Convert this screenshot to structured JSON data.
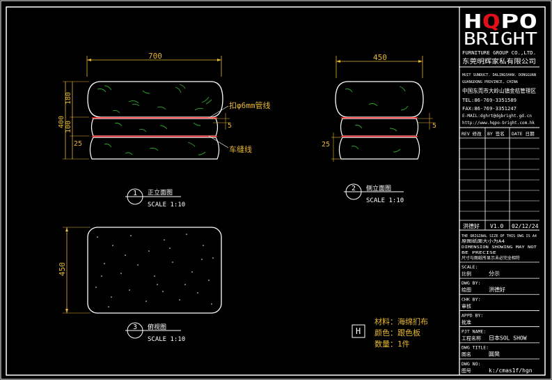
{
  "brand": {
    "logo_line1": "HQPO",
    "logo_line2": "BRIGHT",
    "logo_accent": "#e0101a",
    "company_en": "FURNITURE GROUP CO.,LTD.",
    "company_cn": "东莞明辉家私有限公司"
  },
  "address": {
    "en_line1": "HUIT SUNDUCT. DALINGSHAN. DONGGUAN",
    "en_line2": "GUANGDONG PROVINCE, CHINA",
    "cn_line": "中国东莞市大岭山镇金桔管理区",
    "tel": "TEL:86-769-3351589",
    "fax": "FAX:86-769-3351247",
    "email": "E-MAIL:dghrt@dgbright.gd.cn",
    "web": "http://www.hqpo-bright.com.hk"
  },
  "revision_header": {
    "rev": "REV 修改",
    "by": "BY 签名",
    "date": "DATE 日期"
  },
  "revision_row": {
    "rev": "洪德好",
    "by": "V1.0",
    "date": "02/12/24"
  },
  "notes": {
    "line1": "THE ORIGINAL SIZE OF THIS DWG IS A4",
    "line2": "原图纸面大小为A4",
    "line3": "DIMENSION SHOWING MAY NOT",
    "line4": "BE PRECISE",
    "line5": "尺寸与图纸所显示未必完全相符"
  },
  "title_block": [
    {
      "label_en": "SCALE:",
      "label_cn": "比例",
      "value": "分示"
    },
    {
      "label_en": "DWG BY:",
      "label_cn": "绘图",
      "value": "洪德好"
    },
    {
      "label_en": "CHK BY:",
      "label_cn": "审核",
      "value": ""
    },
    {
      "label_en": "APPD BY:",
      "label_cn": "批准",
      "value": ""
    },
    {
      "label_en": "PJT NAME:",
      "label_cn": "工程名称",
      "value": "日本SOL SHOW"
    },
    {
      "label_en": "DWG TITLE:",
      "label_cn": "图名",
      "value": "圆凳"
    },
    {
      "label_en": "DWG NO:",
      "label_cn": "图号",
      "value": "k:/cmas1f/hgn"
    }
  ],
  "front_view": {
    "width_dim": "700",
    "height_dim": "400",
    "seg_top": "180",
    "seg_mid": "100",
    "seg_bot": "25",
    "tube_note": "扣φ6mm管线",
    "tube_dim": "5",
    "stitch_note": "车缝线",
    "caption_num": "1",
    "caption_title": "正立面图",
    "caption_scale": "SCALE 1:10"
  },
  "side_view": {
    "width_dim": "450",
    "bot_dim": "25",
    "tube_dim": "5",
    "caption_num": "2",
    "caption_title": "侧立面图",
    "caption_scale": "SCALE 1:10"
  },
  "plan_view": {
    "height_dim": "450",
    "caption_num": "3",
    "caption_title": "俯视图",
    "caption_scale": "SCALE 1:10"
  },
  "materials": {
    "tag": "H",
    "line1": "材料：海绵扪布",
    "line2": "颜色：跟色板",
    "line3": "数量：1件"
  },
  "colors": {
    "dim": "#e8b830",
    "line": "#ffffff",
    "pipe": "#ff2020",
    "hatch": "#2ea82e"
  }
}
